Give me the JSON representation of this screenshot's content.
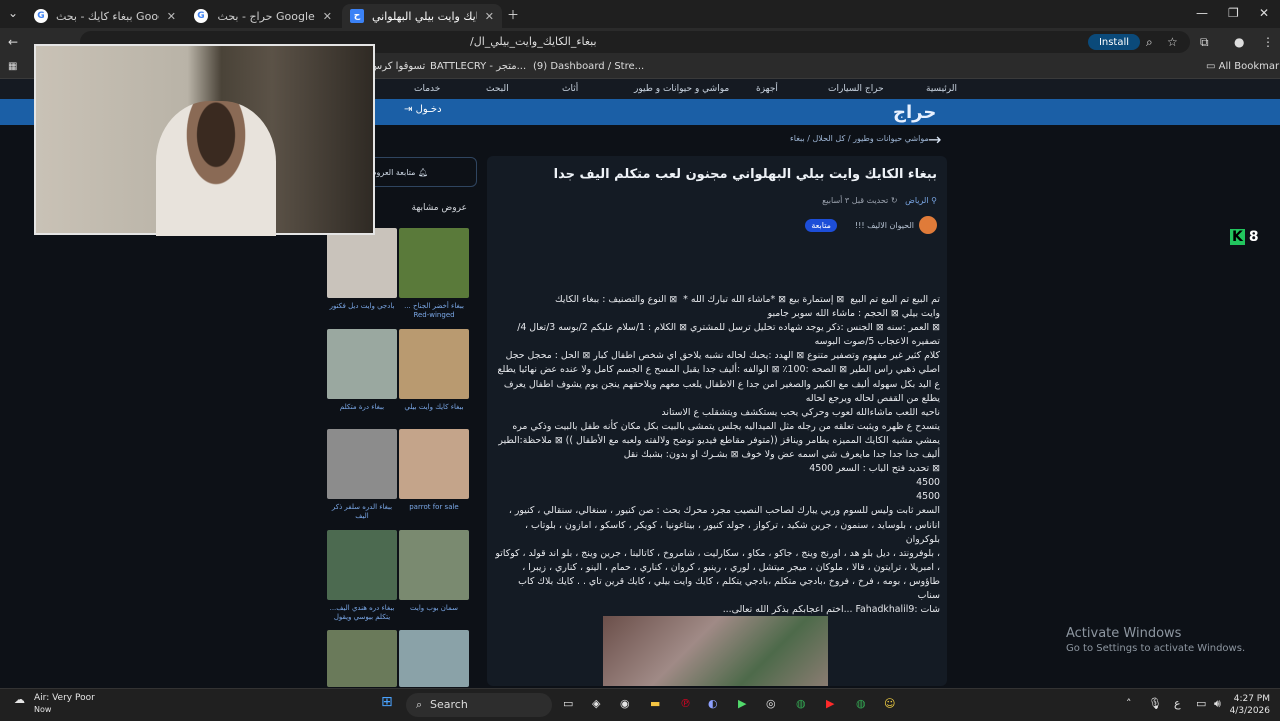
{
  "browser": {
    "tabs": [
      {
        "title": "ببغاء كايك - بحث Google",
        "icon": "google-icon",
        "active": false
      },
      {
        "title": "حراج - بحث Google",
        "icon": "google-icon",
        "active": false
      },
      {
        "title": "ببغاء الكايك وايت بيلي البهلواني",
        "icon": "haraj-icon",
        "active": true
      }
    ],
    "url": "/ببغاء_الكايك_وايت_بيلي_ال",
    "install_label": "Install",
    "bookmarks": [
      "تسوقوا كرس",
      "BATTLECRY - متجر...",
      "(9) Dashboard / Stre...",
      "All Bookmarks"
    ]
  },
  "site": {
    "nav": [
      "الرئيسية",
      "حراج السيارات",
      "أجهزة",
      "مواشي و حيوانات و طيور",
      "أثاث",
      "البحث",
      "خدمات"
    ],
    "logo": "حراج",
    "login": "دخـول",
    "breadcrumb": "مواشي حيوانات وطيور  /  كل الحلال  /  ببغاء"
  },
  "listing": {
    "title": "ببغاء الكايك وايت بيلي البهلواني مجنون لعب متكلم اليف جدا",
    "location": "الرياض",
    "updated": "تحديث قبل ٣ أسابيع",
    "seller": "الحيوان الاليف !!!",
    "follow_label": "متابعة",
    "description": "تم البيع تم البيع تم البيع  ⊠ إستمارة بيع ⊠ *ماشاء الله تبارك الله *  ⊠ النوع والتصنيف : ببغاء الكايك\nوايت بيلي ⊠ الحجم : ماشاء الله سوبر جامبو\n⊠ العمر :سنه ⊠ الجنس :ذكر يوجد شهاده تحليل ترسل للمشتري ⊠ الكلام : 1/سلام عليكم 2/بوسه 3/تعال 4/\nتصفيره الاعجاب 5/صوت البوسه\nكلام كثير غير مفهوم وتصفير متنوع ⊠ الهدد :يحبك لحاله نشبه يلاحق اي شخص اطفال كبار ⊠ الحل : محجل حجل\nاصلي ذهبي راس الطير ⊠ الصحه :100٪ ⊠ الوالفه :أليف جدا يقبل المسح ع الجسم كامل ولا عنده عض نهائيا يطلع\nع اليد بكل سهوله أليف مع الكبير والصغير امن جدا ع الاطفال يلعب معهم ويلاحقهم ينجن يوم يشوف اطفال يعرف\nيطلع من القفص لحاله ويرجع لحاله\nناحيه اللعب ماشاءالله لعوب وحركي يحب يستكشف ويتشقلب ع الاستاند\nيتسدح ع ظهره ويثبت تعلقه من رجله مثل الميداليه يجلس يتمشى بالبيت بكل مكان كأنه طفل بالبيت وذكي مره\nيمشي مشيه الكايك المميزه يطامر ويناقز ((متوفر مقاطع فيديو توضح ولالفته ولعبه مع الأطفال )) ⊠ ملاحظة:الطير\nأليف جدا جدا جدا مايعرف شي اسمه عض ولا خوف ⊠ بشـرك او بدون: بشبك نقل\n⊠ تحديد فتح الباب : السعر 4500\n4500\n4500\nالسعر ثابت وليس للسوم وربي يبارك لصاحب النصيب مجرد محرك بحث : صن كنيور ، سنغالي، سنقالي ، كنيور ،\nاناناس ، بلوسايد ، سنمون ، جرين شكيد ، تركواز ، جولد كنيور ، بيتاغونيا ، كويكر ، كاسكو ، امازون ، بلوتاب ، بلوكروان\n، بلوفرونتد ، ديل بلو هد ، اورنج وينج ، جاكو ، مكاو ، سكارليت ، شامروخ ، كاتالينا ، جرين وينج ، بلو اند قولد ، كوكاتو\n، امبريلا ، ترايتون ، قالا ، ملوكان ، ميجر ميتشل ، لوري ، رينبو ، كروان ، كناري ، حمام ، الينو ، كناري ، زيبرا ،\nطاؤوس ، بومه ، فرخ ، فروخ ،بادجي متكلم ،بادجي يتكلم ، كايك وايت بيلي ، كايك قرين تاي . . كايك بلاك كاب سناب\nشات :Fahadkhalil9 ...اختم اعجابكم بذكر الله تعالى..."
  },
  "sidebar": {
    "follow_label": "متابعة العروض",
    "similar_title": "عروض مشابهة",
    "items": [
      {
        "caption": "ببغاء أخضر الجناح ... Red-winged",
        "color": "#5a7a3a"
      },
      {
        "caption": "بادجي وايت ديل فكتور",
        "color": "#c9c3bb"
      },
      {
        "caption": "ببغاء كايك وايت بيلي",
        "color": "#b99a70"
      },
      {
        "caption": "ببغاء درة متكلم",
        "color": "#9aa8a0"
      },
      {
        "caption": "parrot for sale",
        "color": "#c4a48a"
      },
      {
        "caption": "ببغاء الدره سلفر ذكر اليف",
        "color": "#8c8c8c"
      },
      {
        "caption": "سمان بوب وايت",
        "color": "#7a8a70"
      },
      {
        "caption": "ببغاء دره هندي اليف... يتكلم بيوسي ويقول",
        "color": "#4c6a50"
      },
      {
        "caption": "",
        "color": "#8aa2a8"
      },
      {
        "caption": "",
        "color": "#6a7a5a"
      }
    ]
  },
  "overlay": {
    "kick_count": "8"
  },
  "watermark": {
    "line1": "Activate Windows",
    "line2": "Go to Settings to activate Windows."
  },
  "taskbar": {
    "weather_title": "Air: Very Poor",
    "weather_sub": "Now",
    "search_placeholder": "Search",
    "time": "4:27 PM",
    "date": "4/3/2026",
    "lang": "ع"
  }
}
